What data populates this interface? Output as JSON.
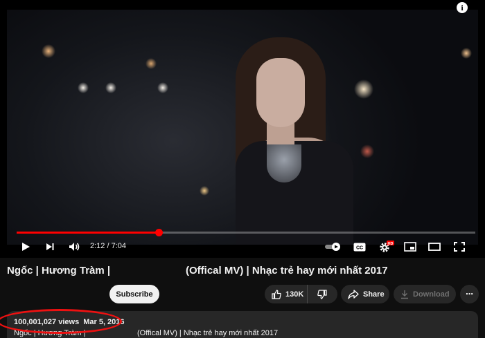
{
  "player": {
    "time_current": "2:12",
    "time_separator": "/",
    "time_total": "7:04",
    "progress_fraction": 0.311,
    "info_label": "i",
    "hd_badge": "HD",
    "cc_label": "CC"
  },
  "title": {
    "part_a": "Ngốc | Hương Tràm |",
    "part_b": "(Offical MV) | Nhạc trẻ hay mới nhất 2017"
  },
  "actions": {
    "subscribe_label": "Subscribe",
    "like_count": "130K",
    "share_label": "Share",
    "download_label": "Download",
    "more_label": "⋯"
  },
  "description": {
    "views": "100,001,027 views",
    "date": "Mar 5, 2016",
    "line_a": "Ngốc | Hương Tràm |",
    "line_b": "(Offical MV) | Nhạc trẻ hay mới nhất 2017"
  },
  "colors": {
    "progress": "#ff0000",
    "background": "#0f0f0f",
    "pill": "#272727",
    "annotation_oval": "#ee1111"
  },
  "icons": [
    "info-icon",
    "play-icon",
    "next-icon",
    "volume-icon",
    "autoplay-toggle-icon",
    "captions-icon",
    "settings-icon",
    "miniplayer-icon",
    "theater-icon",
    "fullscreen-icon",
    "like-icon",
    "dislike-icon",
    "share-icon",
    "download-icon",
    "more-icon"
  ]
}
